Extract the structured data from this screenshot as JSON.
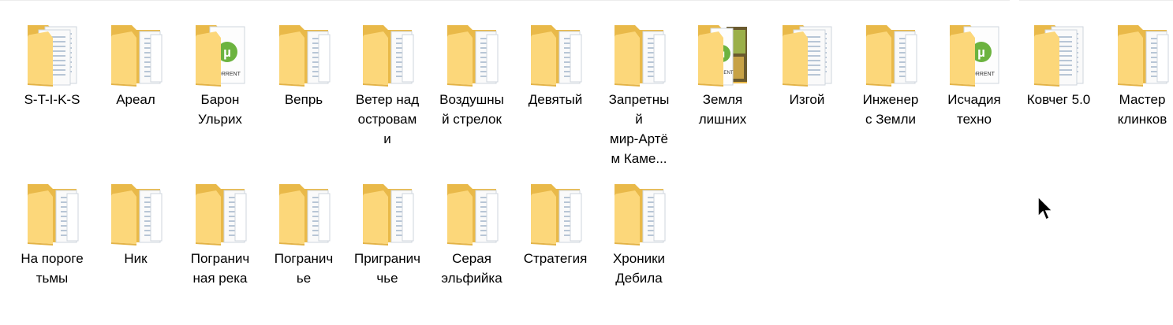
{
  "folders": [
    {
      "name": "S-T-I-K-S",
      "icon": "folder-doc-icon"
    },
    {
      "name": "Ареал",
      "icon": "folder-icon"
    },
    {
      "name": "Барон\nУльрих",
      "icon": "folder-torrent-icon",
      "torrent_label": "TORRENT"
    },
    {
      "name": "Вепрь",
      "icon": "folder-icon"
    },
    {
      "name": "Ветер над\nостровам\nи",
      "icon": "folder-icon"
    },
    {
      "name": "Воздушны\nй стрелок",
      "icon": "folder-icon"
    },
    {
      "name": "Девятый",
      "icon": "folder-icon"
    },
    {
      "name": "Запретны\nй\nмир-Артё\nм Каме...",
      "icon": "folder-icon"
    },
    {
      "name": "Земля\nлишних",
      "icon": "folder-torrent-photo-icon",
      "torrent_label": "TORRENT"
    },
    {
      "name": "Изгой",
      "icon": "folder-doc-icon"
    },
    {
      "name": "Инженер\nс Земли",
      "icon": "folder-icon"
    },
    {
      "name": "Исчадия\nтехно",
      "icon": "folder-torrent-icon",
      "torrent_label": "TORRENT"
    },
    {
      "name": "Ковчег 5.0",
      "icon": "folder-doc-icon"
    },
    {
      "name": "Мастер\nклинков",
      "icon": "folder-icon"
    },
    {
      "name": "На пороге\nтьмы",
      "icon": "folder-icon"
    },
    {
      "name": "Ник",
      "icon": "folder-icon"
    },
    {
      "name": "Погранич\nная река",
      "icon": "folder-icon"
    },
    {
      "name": "Погранич\nье",
      "icon": "folder-icon"
    },
    {
      "name": "Пригранич\nчье",
      "icon": "folder-icon"
    },
    {
      "name": "Серая\nэльфийка",
      "icon": "folder-icon"
    },
    {
      "name": "Стратегия",
      "icon": "folder-icon"
    },
    {
      "name": "Хроники\nДебила",
      "icon": "folder-icon"
    }
  ],
  "colors": {
    "folder_back": "#e9b949",
    "folder_front": "#fcd77a",
    "torrent_green": "#6cb33f",
    "text": "#000000"
  }
}
